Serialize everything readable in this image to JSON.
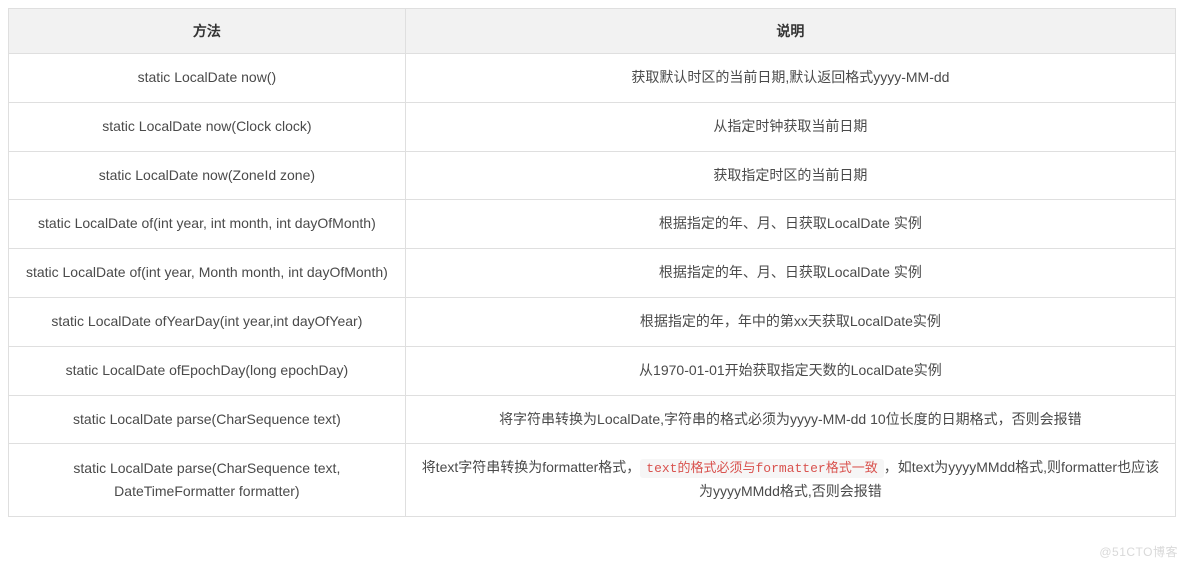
{
  "table": {
    "header": {
      "method": "方法",
      "desc": "说明"
    },
    "rows": [
      {
        "method": "static LocalDate now()",
        "desc": "获取默认时区的当前日期,默认返回格式yyyy-MM-dd"
      },
      {
        "method": "static LocalDate now(Clock clock)",
        "desc": "从指定时钟获取当前日期"
      },
      {
        "method": "static LocalDate now(ZoneId zone)",
        "desc": "获取指定时区的当前日期"
      },
      {
        "method": "static LocalDate of(int year, int month, int dayOfMonth)",
        "desc": "根据指定的年、月、日获取LocalDate 实例"
      },
      {
        "method": "static LocalDate of(int year, Month month, int dayOfMonth)",
        "desc": "根据指定的年、月、日获取LocalDate 实例"
      },
      {
        "method": "static LocalDate ofYearDay(int year,int dayOfYear)",
        "desc": "根据指定的年，年中的第xx天获取LocalDate实例"
      },
      {
        "method": "static LocalDate ofEpochDay(long epochDay)",
        "desc": "从1970-01-01开始获取指定天数的LocalDate实例"
      },
      {
        "method": "static LocalDate parse(CharSequence text)",
        "desc": "将字符串转换为LocalDate,字符串的格式必须为yyyy-MM-dd 10位长度的日期格式，否则会报错"
      }
    ],
    "last_row": {
      "method": "static LocalDate parse(CharSequence text, DateTimeFormatter formatter)",
      "desc_pre": "将text字符串转换为formatter格式，",
      "desc_code": "text的格式必须与formatter格式一致",
      "desc_post": "，如text为yyyyMMdd格式,则formatter也应该为yyyyMMdd格式,否则会报错"
    }
  },
  "watermark": "@51CTO博客"
}
